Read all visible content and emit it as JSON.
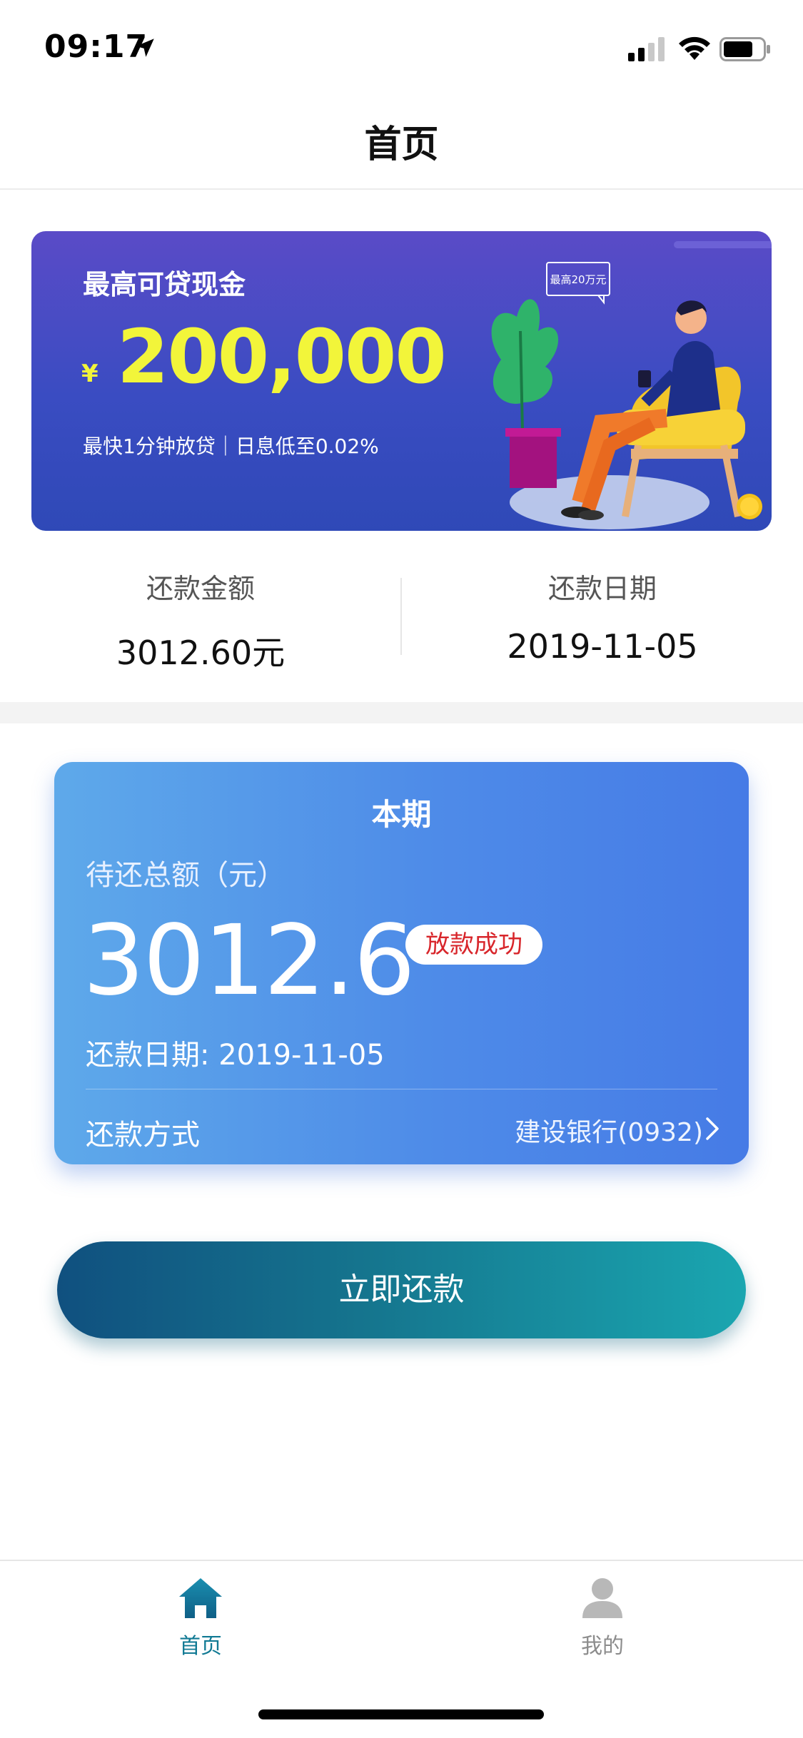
{
  "status_bar": {
    "time": "09:17"
  },
  "nav": {
    "title": "首页"
  },
  "banner": {
    "title": "最高可贷现金",
    "currency": "¥",
    "amount": "200,000",
    "subtitle": "最快1分钟放贷｜日息低至0.02%",
    "bubble_text": "最高20万元",
    "coin_symbol": "¥"
  },
  "summary": {
    "amount_label": "还款金额",
    "amount_value": "3012.60元",
    "date_label": "还款日期",
    "date_value": "2019-11-05"
  },
  "bill": {
    "title": "本期",
    "pending_label": "待还总额（元）",
    "amount": "3012.6",
    "status_badge": "放款成功",
    "due_date": "还款日期: 2019-11-05",
    "method_label": "还款方式",
    "method_value": "建设银行(0932)"
  },
  "actions": {
    "pay_label": "立即还款"
  },
  "tabbar": {
    "items": [
      {
        "label": "首页",
        "icon": "home-icon",
        "active": true
      },
      {
        "label": "我的",
        "icon": "user-icon",
        "active": false
      }
    ]
  },
  "colors": {
    "brand_teal": "#117a94",
    "banner_amount": "#f2f53a",
    "badge_red": "#d8262b",
    "card_blue": "#4e8be8"
  }
}
